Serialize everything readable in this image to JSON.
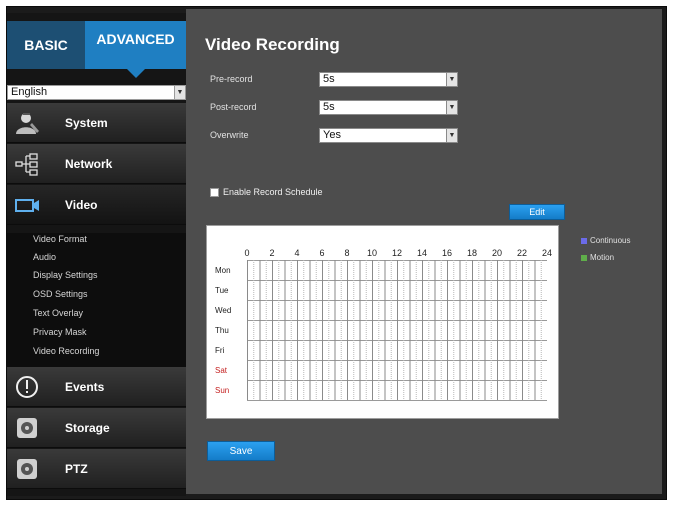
{
  "mode_tabs": {
    "basic": "Basic",
    "advanced": "Advanced"
  },
  "language": {
    "selected": "English"
  },
  "nav": {
    "system": "System",
    "network": "Network",
    "video": "Video",
    "events": "Events",
    "storage": "Storage",
    "ptz": "PTZ"
  },
  "video_submenu": [
    "Video Format",
    "Audio",
    "Display Settings",
    "OSD Settings",
    "Text Overlay",
    "Privacy Mask",
    "Video Recording"
  ],
  "page": {
    "title": "Video Recording",
    "pre_record": {
      "label": "Pre-record",
      "value": "5s"
    },
    "post_record": {
      "label": "Post-record",
      "value": "5s"
    },
    "overwrite": {
      "label": "Overwrite",
      "value": "Yes"
    },
    "enable_schedule": {
      "label": "Enable Record Schedule",
      "checked": false
    },
    "edit_label": "Edit",
    "save_label": "Save"
  },
  "schedule": {
    "hours": [
      "0",
      "2",
      "4",
      "6",
      "8",
      "10",
      "12",
      "14",
      "16",
      "18",
      "20",
      "22",
      "24"
    ],
    "days": [
      "Mon",
      "Tue",
      "Wed",
      "Thu",
      "Fri",
      "Sat",
      "Sun"
    ],
    "weekend_color": "#c42020"
  },
  "legend": [
    {
      "label": "Continuous",
      "color": "#6b6be8"
    },
    {
      "label": "Motion",
      "color": "#5fae4a"
    }
  ],
  "colors": {
    "accent": "#1f7fc2",
    "button": "#2ba0f0"
  },
  "icons": {
    "system": "admin-person-icon",
    "network": "network-tree-icon",
    "video": "video-camera-icon",
    "events": "alert-circle-icon",
    "storage": "disk-icon",
    "ptz": "ptz-disk-icon"
  }
}
